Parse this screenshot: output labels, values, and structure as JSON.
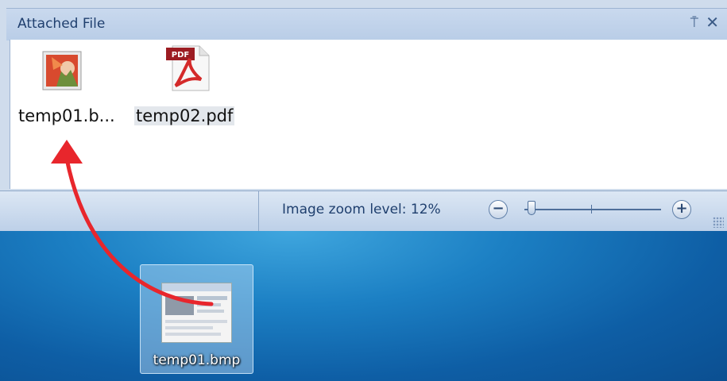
{
  "panel": {
    "title": "Attached File",
    "pin_glyph": "⍑",
    "close_glyph": "✕",
    "files": [
      {
        "label": "temp01.b...",
        "icon": "bitmap-image-icon"
      },
      {
        "label": "temp02.pdf",
        "icon": "pdf-file-icon",
        "badge": "PDF"
      }
    ]
  },
  "statusbar": {
    "zoom_label": "Image zoom level:",
    "zoom_value": "12%",
    "zoom_minus": "−",
    "zoom_plus": "+",
    "zoom_slider_fraction": 0.05
  },
  "desktop": {
    "icon_label": "temp01.bmp",
    "icon": "bitmap-file-thumbnail"
  },
  "annotation": {
    "arrow_color": "#e8262c",
    "meaning": "drag-drop-arrow"
  },
  "colors": {
    "panel_header": "#c9d9ee",
    "panel_title": "#1f3f6e",
    "desktop_blue": "#1c80c4"
  }
}
